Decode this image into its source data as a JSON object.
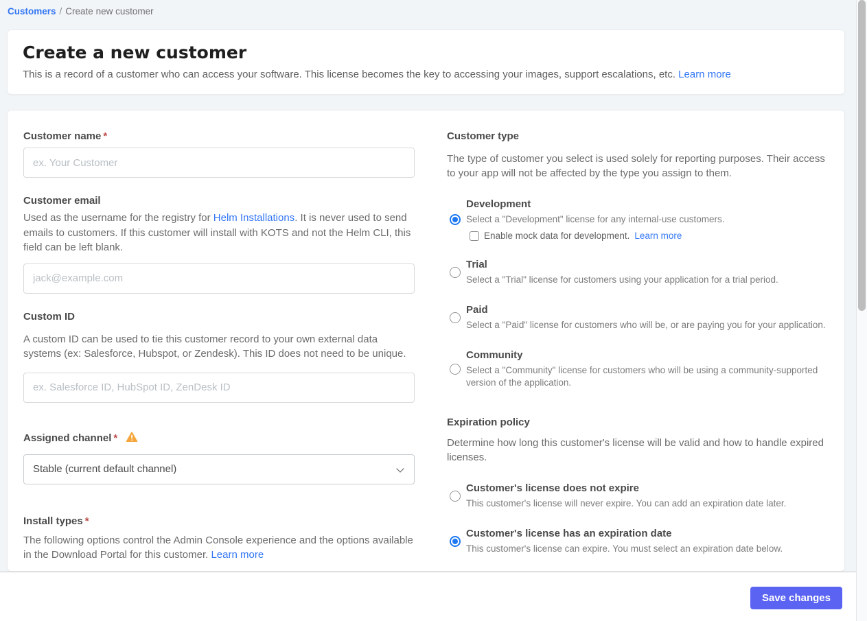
{
  "breadcrumb": {
    "link": "Customers",
    "separator": "/",
    "current": "Create new customer"
  },
  "header": {
    "title": "Create a new customer",
    "description": "This is a record of a customer who can access your software. This license becomes the key to accessing your images, support escalations, etc.",
    "learn_more": "Learn more"
  },
  "form": {
    "customer_name": {
      "label": "Customer name",
      "required": "*",
      "placeholder": "ex. Your Customer"
    },
    "customer_email": {
      "label": "Customer email",
      "description_before_link": "Used as the username for the registry for ",
      "link": "Helm Installations",
      "description_after_link": ". It is never used to send emails to customers. If this customer will install with KOTS and not the Helm CLI, this field can be left blank.",
      "placeholder": "jack@example.com"
    },
    "custom_id": {
      "label": "Custom ID",
      "description": "A custom ID can be used to tie this customer record to your own external data systems (ex: Salesforce, Hubspot, or Zendesk). This ID does not need to be unique.",
      "placeholder": "ex. Salesforce ID, HubSpot ID, ZenDesk ID"
    },
    "assigned_channel": {
      "label": "Assigned channel",
      "required": "*",
      "selected": "Stable (current default channel)"
    },
    "install_types": {
      "label": "Install types",
      "required": "*",
      "description": "The following options control the Admin Console experience and the options available in the Download Portal for this customer.",
      "learn_more": "Learn more"
    },
    "customer_type": {
      "label": "Customer type",
      "description": "The type of customer you select is used solely for reporting purposes. Their access to your app will not be affected by the type you assign to them.",
      "options": [
        {
          "label": "Development",
          "description": "Select a \"Development\" license for any internal-use customers.",
          "selected": true,
          "checkbox": {
            "label": "Enable mock data for development.",
            "learn_more": "Learn more",
            "checked": false
          }
        },
        {
          "label": "Trial",
          "description": "Select a \"Trial\" license for customers using your application for a trial period.",
          "selected": false
        },
        {
          "label": "Paid",
          "description": "Select a \"Paid\" license for customers who will be, or are paying you for your application.",
          "selected": false
        },
        {
          "label": "Community",
          "description": "Select a \"Community\" license for customers who will be using a community-supported version of the application.",
          "selected": false
        }
      ]
    },
    "expiration_policy": {
      "label": "Expiration policy",
      "description": "Determine how long this customer's license will be valid and how to handle expired licenses.",
      "options": [
        {
          "label": "Customer's license does not expire",
          "description": "This customer's license will never expire. You can add an expiration date later.",
          "selected": false
        },
        {
          "label": "Customer's license has an expiration date",
          "description": "This customer's license can expire. You must select an expiration date below.",
          "selected": true
        }
      ]
    }
  },
  "footer": {
    "save_button": "Save changes"
  },
  "colors": {
    "accent_link_blue": "#3276f5",
    "radio_blue": "#1d78f2",
    "button_indigo": "#5a63f2",
    "warning_amber": "#f6a53a",
    "required_red": "#bc4a48",
    "page_background": "#f2f5f7"
  }
}
